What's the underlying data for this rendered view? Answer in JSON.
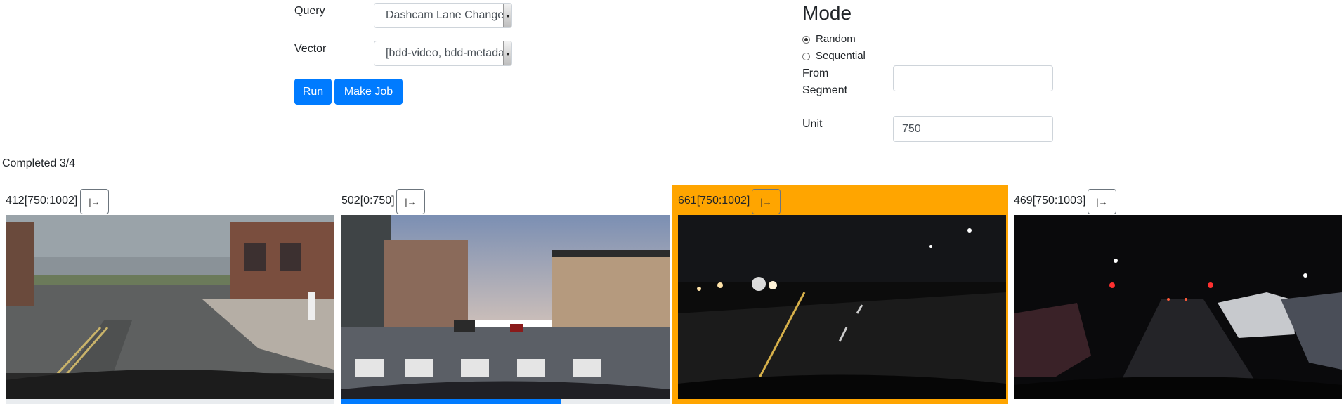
{
  "form": {
    "query_label": "Query",
    "query_value": "Dashcam Lane Change",
    "vector_label": "Vector",
    "vector_value": "[bdd-video, bdd-metadata]",
    "run_label": "Run",
    "make_job_label": "Make Job"
  },
  "mode": {
    "title": "Mode",
    "options": [
      {
        "label": "Random",
        "checked": true
      },
      {
        "label": "Sequential",
        "checked": false
      }
    ],
    "from_segment_label": "From Segment",
    "from_segment_value": "",
    "unit_label": "Unit",
    "unit_value": "750"
  },
  "status": "Completed 3/4",
  "jump_icon_glyph": "|→",
  "results": [
    {
      "label": "412[750:1002]",
      "selected": false,
      "progress": 0,
      "scene": "day-parking-lot"
    },
    {
      "label": "502[0:750]",
      "selected": false,
      "progress": 0.67,
      "scene": "dusk-city-street"
    },
    {
      "label": "661[750:1002]",
      "selected": true,
      "progress": 0,
      "scene": "night-highway"
    },
    {
      "label": "469[750:1003]",
      "selected": false,
      "progress": 0,
      "scene": "night-residential"
    }
  ],
  "colors": {
    "primary": "#007bff",
    "selected": "#ffa500"
  }
}
